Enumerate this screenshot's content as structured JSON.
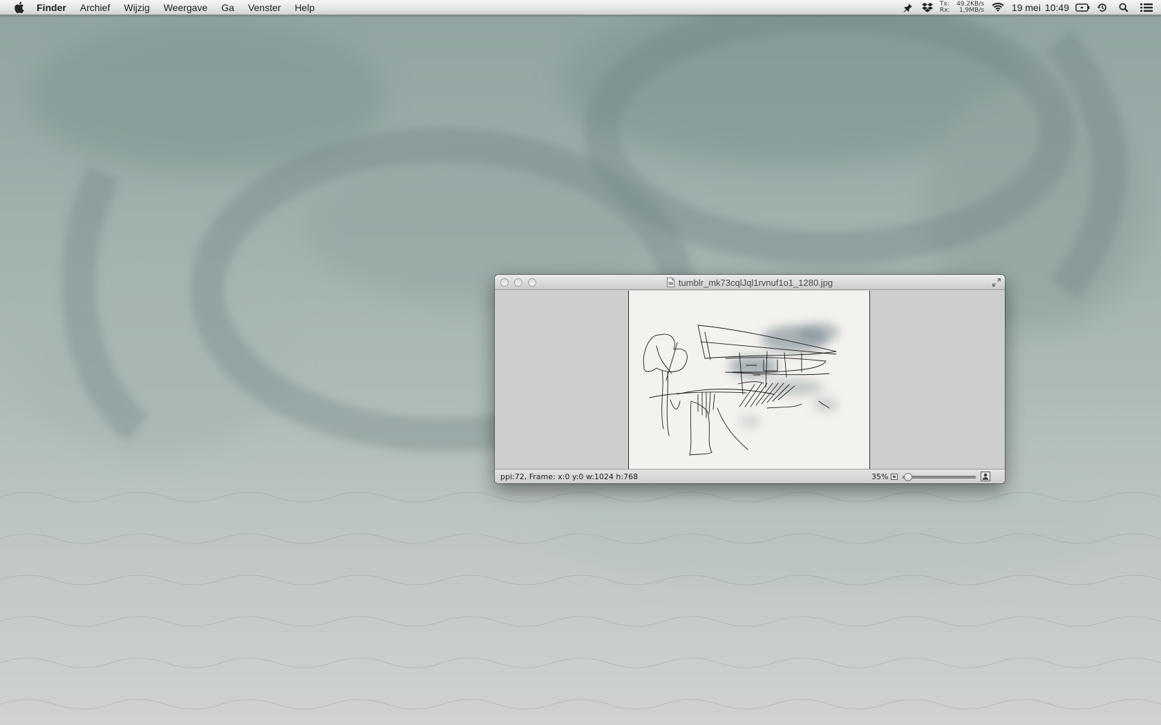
{
  "menubar": {
    "apple_icon": "apple-logo-icon",
    "items": [
      {
        "label": "Finder"
      },
      {
        "label": "Archief"
      },
      {
        "label": "Wijzig"
      },
      {
        "label": "Weergave"
      },
      {
        "label": "Ga"
      },
      {
        "label": "Venster"
      },
      {
        "label": "Help"
      }
    ],
    "status": {
      "icons": [
        "pin-icon",
        "dropbox-icon",
        "wifi-icon",
        "battery-icon",
        "time-machine-icon",
        "spotlight-icon",
        "notification-center-icon"
      ],
      "net_tx_label": "Tx:",
      "net_tx_value": "49,2KB/s",
      "net_rx_label": "Rx:",
      "net_rx_value": "1,9MB/s",
      "date": "19 mei",
      "time": "10:49"
    }
  },
  "window": {
    "title": "tumblr_mk73cqlJql1rvnuf1o1_1280.jpg",
    "title_icon": "document-icon",
    "status_info": "ppi:72, Frame: x:0 y:0 w:1024 h:768",
    "zoom_label": "35%",
    "zoom_fraction": 0.03
  },
  "colors": {
    "desktop_top": "#8fa3a0",
    "desktop_bottom": "#cfd2d0",
    "window_chrome": "#d6d6d6",
    "canvas_bg": "#cecece",
    "image_bg": "#f4f2ee"
  }
}
